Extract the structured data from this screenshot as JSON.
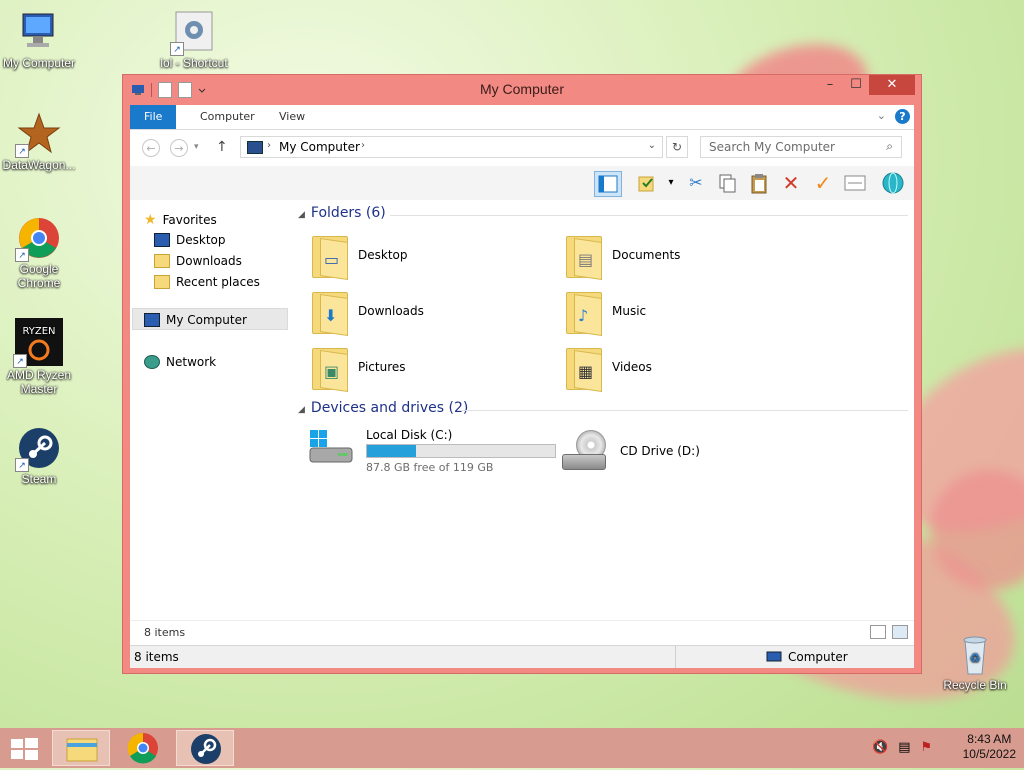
{
  "desktop": {
    "icons": [
      {
        "label": "My Computer"
      },
      {
        "label": "lol - Shortcut"
      },
      {
        "label": "DataWagon..."
      },
      {
        "label": "Google Chrome"
      },
      {
        "label": "AMD Ryzen Master"
      },
      {
        "label": "Steam"
      },
      {
        "label": "Recycle Bin"
      }
    ],
    "ryzen_logo_text": "RYZEN"
  },
  "window": {
    "title": "My Computer",
    "controls": {
      "minimize": "–",
      "maximize": "☐",
      "close": "✕"
    },
    "ribbon": {
      "tabs": [
        "File",
        "Computer",
        "View"
      ],
      "help": "?"
    },
    "address": {
      "path": "My Computer",
      "search_placeholder": "Search My Computer"
    },
    "nav": {
      "favorites": "Favorites",
      "desktop": "Desktop",
      "downloads": "Downloads",
      "recent": "Recent places",
      "computer": "My Computer",
      "network": "Network"
    },
    "folders_header": "Folders (6)",
    "folders": [
      "Desktop",
      "Documents",
      "Downloads",
      "Music",
      "Pictures",
      "Videos"
    ],
    "devices_header": "Devices and drives (2)",
    "drives": {
      "local": {
        "name": "Local Disk (C:)",
        "free": "87.8 GB free of 119 GB",
        "used_fraction": 0.26
      },
      "cd": {
        "name": "CD Drive (D:)"
      }
    },
    "item_count": "8 items",
    "status": {
      "left": "8 items",
      "right": "Computer"
    }
  },
  "taskbar": {
    "time": "8:43 AM",
    "date": "10/5/2022"
  },
  "colors": {
    "window_frame": "#f28a83",
    "accent_blue": "#1979ca",
    "taskbar": "#d79c8f"
  }
}
